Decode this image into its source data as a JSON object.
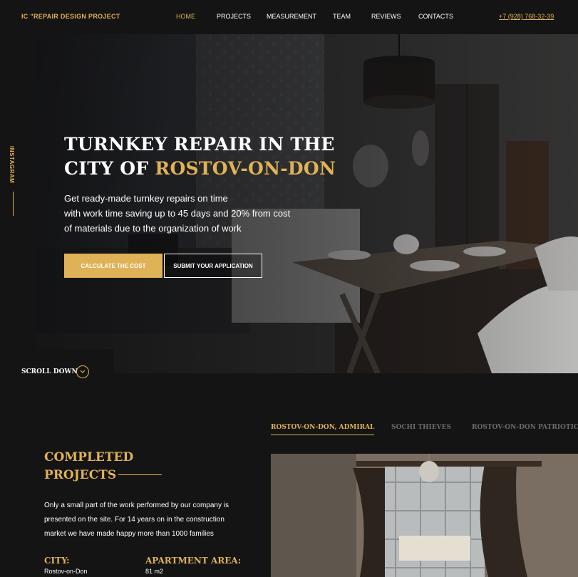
{
  "header": {
    "logo": "IC \"REPAIR DESIGN PROJECT",
    "nav": [
      "HOME",
      "PROJECTS",
      "MEASUREMENT",
      "TEAM",
      "REVIEWS",
      "CONTACTS"
    ],
    "active_nav": "HOME",
    "phone": "+7 (928) 768-32-39"
  },
  "sidebar": {
    "instagram": "INSTAGRAM"
  },
  "hero": {
    "title_line1": "TURNKEY REPAIR IN THE",
    "title_line2_prefix": "CITY OF ",
    "title_line2_highlight": "ROSTOV-ON-DON",
    "text_line1": "Get ready-made turnkey repairs on time",
    "text_line2": "with work time saving up to 45 days and 20% from cost",
    "text_line3": "of materials due to the organization of work",
    "btn_primary": "CALCULATE THE COST",
    "btn_secondary": "SUBMIT YOUR APPLICATION"
  },
  "scroll": {
    "label": "SCROLL DOWN"
  },
  "projects": {
    "tabs": [
      "ROSTOV-ON-DON, ADMIRAL",
      "SOCHI THIEVES",
      "ROSTOV-ON-DON PATRIOTIC"
    ],
    "active_tab": 0,
    "title_line1": "COMPLETED",
    "title_line2": "PROJECTS",
    "text_line1": "Only a small part of the work performed by our company is",
    "text_line2": "presented on the site. For 14 years on in the construction",
    "text_line3": "market we have made happy more than 1000 families",
    "city_label": "CITY:",
    "city_value": "Rostov-on-Don",
    "area_label": "APARTMENT AREA:",
    "area_value": "81 m2"
  },
  "colors": {
    "accent": "#e0b257",
    "background": "#141414",
    "inactive_tab": "#6b6b6b"
  }
}
